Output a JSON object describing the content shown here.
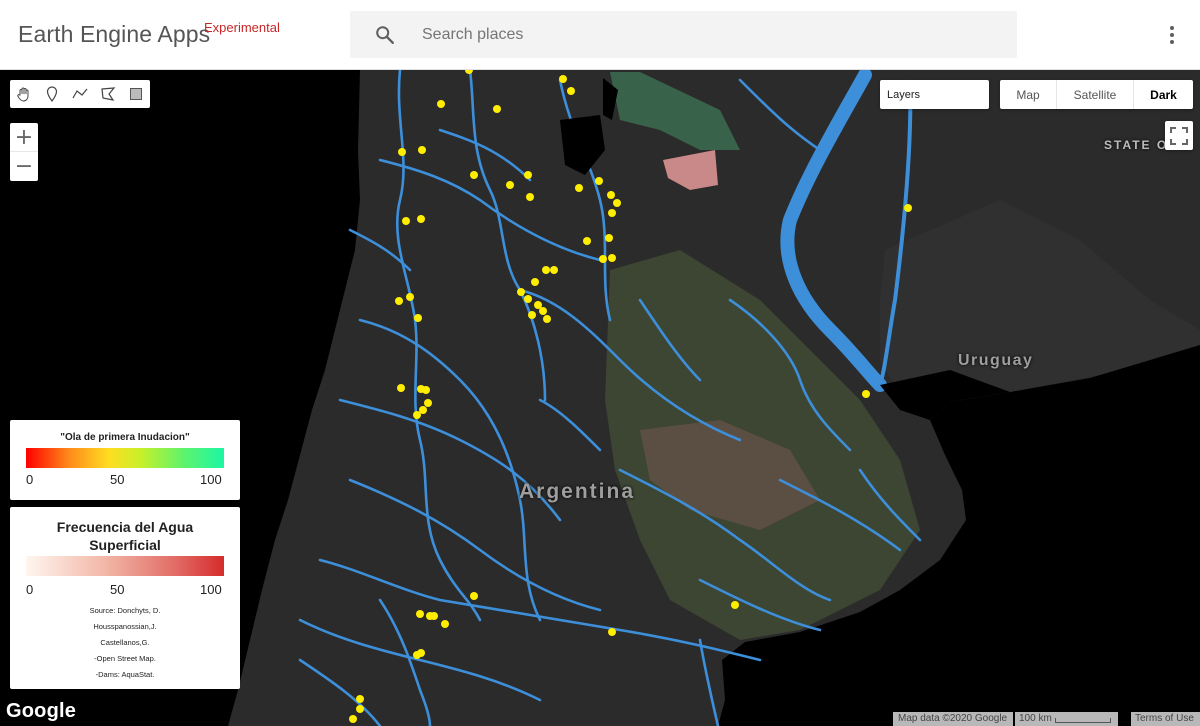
{
  "header": {
    "title": "Earth Engine Apps",
    "badge": "Experimental",
    "search_placeholder": "Search places",
    "more_icon": "more-vert-icon"
  },
  "map": {
    "layers_label": "Layers",
    "map_types": [
      {
        "label": "Map",
        "active": false
      },
      {
        "label": "Satellite",
        "active": false
      },
      {
        "label": "Dark",
        "active": true
      }
    ],
    "zoom_in": "+",
    "zoom_out": "−",
    "draw_tools": [
      "hand-icon",
      "marker-icon",
      "polyline-icon",
      "polygon-icon",
      "rectangle-icon"
    ],
    "labels": {
      "argentina": "Argentina",
      "uruguay": "Uruguay",
      "state": "STATE OF"
    },
    "attribution": {
      "logo": "Google",
      "map_data": "Map data ©2020 Google",
      "scale": "100 km",
      "terms": "Terms of Use"
    },
    "colors": {
      "rivers": "#3d8fd9",
      "dams": "#ffee00",
      "land": "#2b2b2b",
      "sea": "#000000"
    }
  },
  "legend_flood": {
    "title": "\"Ola de primera Inudacion\"",
    "ticks": [
      "0",
      "50",
      "100"
    ]
  },
  "legend_water": {
    "title": "Frecuencia del Agua Superficial",
    "ticks": [
      "0",
      "50",
      "100"
    ],
    "sources": [
      "Source: Donchyts, D.",
      "Housspanossian,J.",
      "Castellanos,G.",
      "-Open Street Map.",
      "-Dams: AquaStat."
    ]
  }
}
